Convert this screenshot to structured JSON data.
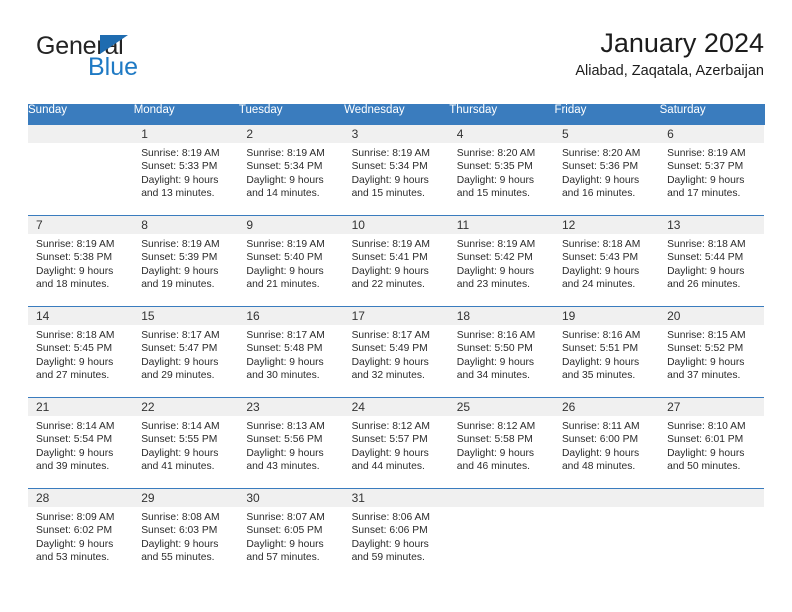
{
  "brand": {
    "name_dark": "General",
    "name_blue": "Blue",
    "triangle_color": "#1f6cb0",
    "blue_color": "#1f7ac4"
  },
  "header": {
    "title": "January 2024",
    "subtitle": "Aliabad, Zaqatala, Azerbaijan"
  },
  "theme": {
    "header_bg": "#3a7cbe",
    "daynum_bg": "#f0f0f0",
    "separator": "#3a7cbe"
  },
  "weekdays": [
    "Sunday",
    "Monday",
    "Tuesday",
    "Wednesday",
    "Thursday",
    "Friday",
    "Saturday"
  ],
  "weeks": [
    [
      {
        "day": "",
        "text": ""
      },
      {
        "day": "1",
        "text": "Sunrise: 8:19 AM\nSunset: 5:33 PM\nDaylight: 9 hours\nand 13 minutes."
      },
      {
        "day": "2",
        "text": "Sunrise: 8:19 AM\nSunset: 5:34 PM\nDaylight: 9 hours\nand 14 minutes."
      },
      {
        "day": "3",
        "text": "Sunrise: 8:19 AM\nSunset: 5:34 PM\nDaylight: 9 hours\nand 15 minutes."
      },
      {
        "day": "4",
        "text": "Sunrise: 8:20 AM\nSunset: 5:35 PM\nDaylight: 9 hours\nand 15 minutes."
      },
      {
        "day": "5",
        "text": "Sunrise: 8:20 AM\nSunset: 5:36 PM\nDaylight: 9 hours\nand 16 minutes."
      },
      {
        "day": "6",
        "text": "Sunrise: 8:19 AM\nSunset: 5:37 PM\nDaylight: 9 hours\nand 17 minutes."
      }
    ],
    [
      {
        "day": "7",
        "text": "Sunrise: 8:19 AM\nSunset: 5:38 PM\nDaylight: 9 hours\nand 18 minutes."
      },
      {
        "day": "8",
        "text": "Sunrise: 8:19 AM\nSunset: 5:39 PM\nDaylight: 9 hours\nand 19 minutes."
      },
      {
        "day": "9",
        "text": "Sunrise: 8:19 AM\nSunset: 5:40 PM\nDaylight: 9 hours\nand 21 minutes."
      },
      {
        "day": "10",
        "text": "Sunrise: 8:19 AM\nSunset: 5:41 PM\nDaylight: 9 hours\nand 22 minutes."
      },
      {
        "day": "11",
        "text": "Sunrise: 8:19 AM\nSunset: 5:42 PM\nDaylight: 9 hours\nand 23 minutes."
      },
      {
        "day": "12",
        "text": "Sunrise: 8:18 AM\nSunset: 5:43 PM\nDaylight: 9 hours\nand 24 minutes."
      },
      {
        "day": "13",
        "text": "Sunrise: 8:18 AM\nSunset: 5:44 PM\nDaylight: 9 hours\nand 26 minutes."
      }
    ],
    [
      {
        "day": "14",
        "text": "Sunrise: 8:18 AM\nSunset: 5:45 PM\nDaylight: 9 hours\nand 27 minutes."
      },
      {
        "day": "15",
        "text": "Sunrise: 8:17 AM\nSunset: 5:47 PM\nDaylight: 9 hours\nand 29 minutes."
      },
      {
        "day": "16",
        "text": "Sunrise: 8:17 AM\nSunset: 5:48 PM\nDaylight: 9 hours\nand 30 minutes."
      },
      {
        "day": "17",
        "text": "Sunrise: 8:17 AM\nSunset: 5:49 PM\nDaylight: 9 hours\nand 32 minutes."
      },
      {
        "day": "18",
        "text": "Sunrise: 8:16 AM\nSunset: 5:50 PM\nDaylight: 9 hours\nand 34 minutes."
      },
      {
        "day": "19",
        "text": "Sunrise: 8:16 AM\nSunset: 5:51 PM\nDaylight: 9 hours\nand 35 minutes."
      },
      {
        "day": "20",
        "text": "Sunrise: 8:15 AM\nSunset: 5:52 PM\nDaylight: 9 hours\nand 37 minutes."
      }
    ],
    [
      {
        "day": "21",
        "text": "Sunrise: 8:14 AM\nSunset: 5:54 PM\nDaylight: 9 hours\nand 39 minutes."
      },
      {
        "day": "22",
        "text": "Sunrise: 8:14 AM\nSunset: 5:55 PM\nDaylight: 9 hours\nand 41 minutes."
      },
      {
        "day": "23",
        "text": "Sunrise: 8:13 AM\nSunset: 5:56 PM\nDaylight: 9 hours\nand 43 minutes."
      },
      {
        "day": "24",
        "text": "Sunrise: 8:12 AM\nSunset: 5:57 PM\nDaylight: 9 hours\nand 44 minutes."
      },
      {
        "day": "25",
        "text": "Sunrise: 8:12 AM\nSunset: 5:58 PM\nDaylight: 9 hours\nand 46 minutes."
      },
      {
        "day": "26",
        "text": "Sunrise: 8:11 AM\nSunset: 6:00 PM\nDaylight: 9 hours\nand 48 minutes."
      },
      {
        "day": "27",
        "text": "Sunrise: 8:10 AM\nSunset: 6:01 PM\nDaylight: 9 hours\nand 50 minutes."
      }
    ],
    [
      {
        "day": "28",
        "text": "Sunrise: 8:09 AM\nSunset: 6:02 PM\nDaylight: 9 hours\nand 53 minutes."
      },
      {
        "day": "29",
        "text": "Sunrise: 8:08 AM\nSunset: 6:03 PM\nDaylight: 9 hours\nand 55 minutes."
      },
      {
        "day": "30",
        "text": "Sunrise: 8:07 AM\nSunset: 6:05 PM\nDaylight: 9 hours\nand 57 minutes."
      },
      {
        "day": "31",
        "text": "Sunrise: 8:06 AM\nSunset: 6:06 PM\nDaylight: 9 hours\nand 59 minutes."
      },
      {
        "day": "",
        "text": ""
      },
      {
        "day": "",
        "text": ""
      },
      {
        "day": "",
        "text": ""
      }
    ]
  ]
}
